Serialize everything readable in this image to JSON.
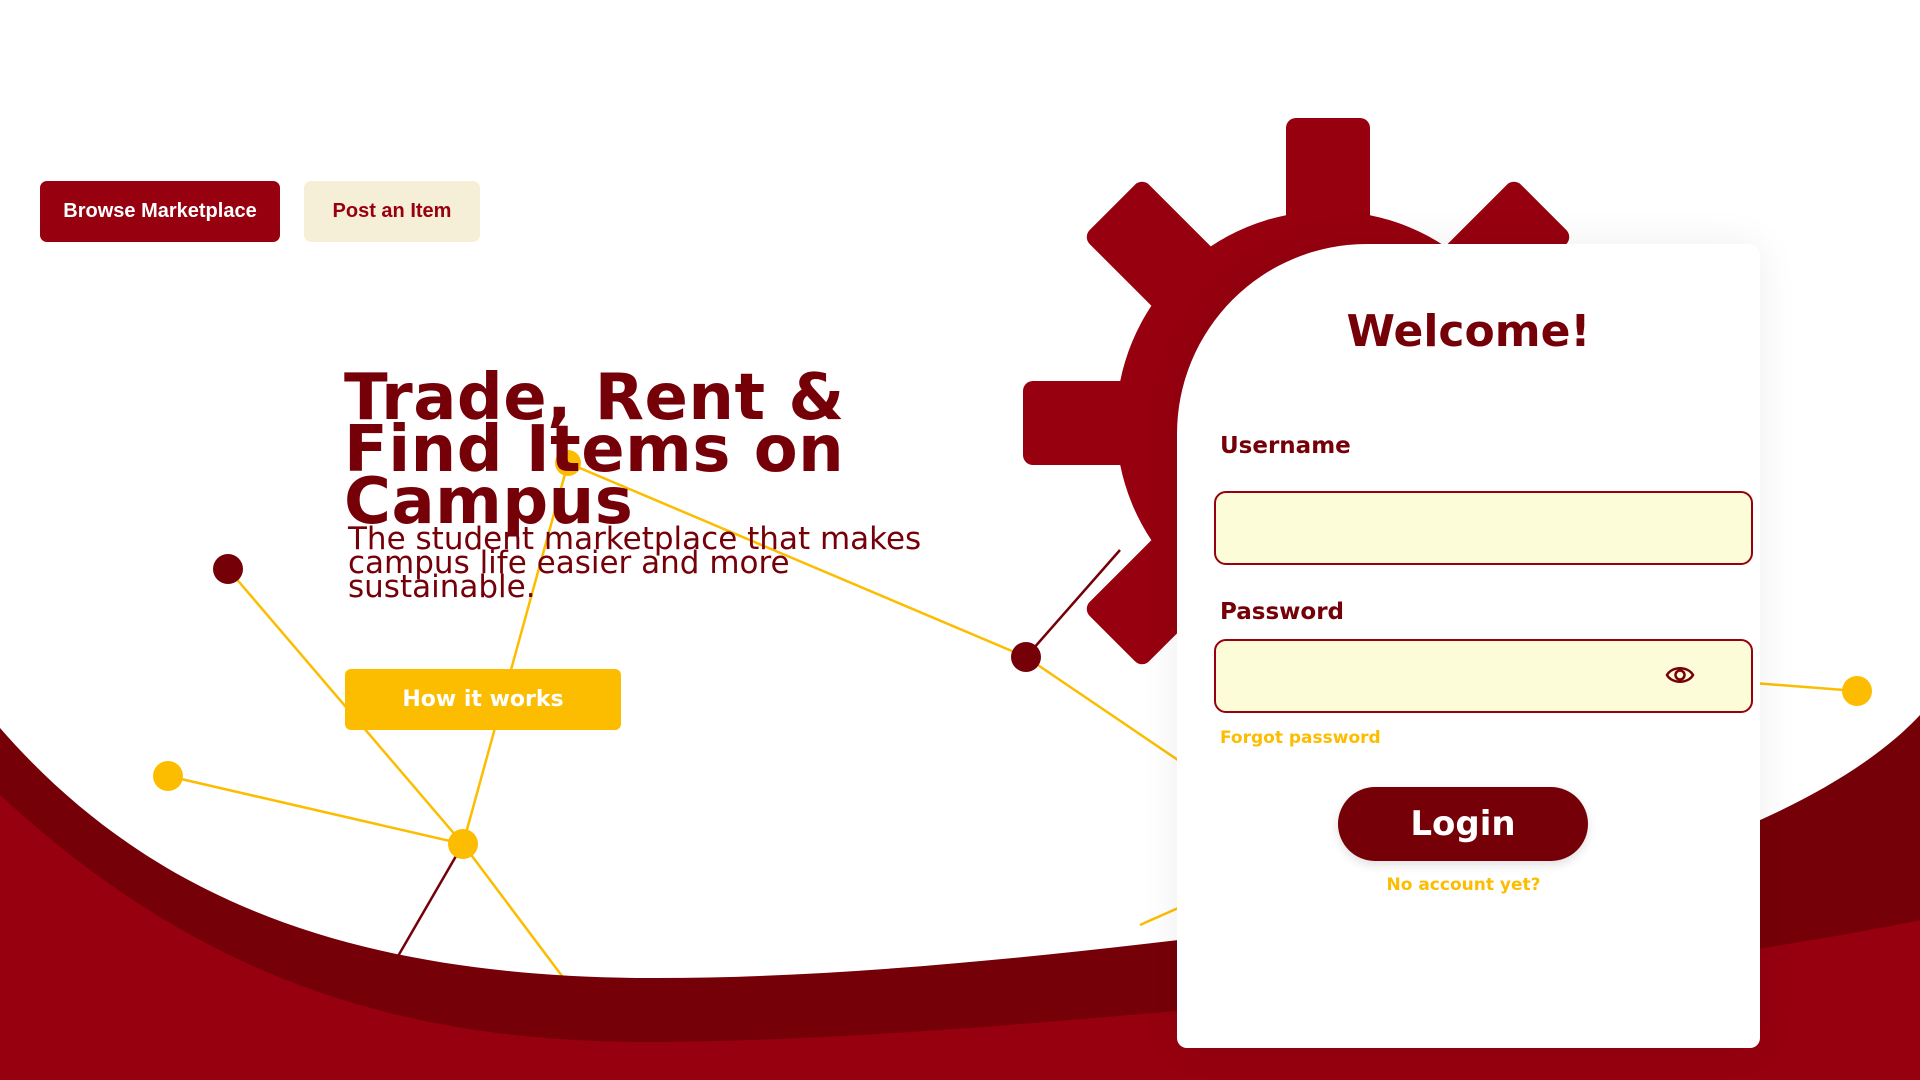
{
  "nav": {
    "browse_label": "Browse Marketplace",
    "post_label": "Post an Item"
  },
  "hero": {
    "title": "Trade, Rent & Find Items on Campus",
    "subtitle": "The student marketplace that makes campus life easier and more sustainable.",
    "how_label": "How it works"
  },
  "login": {
    "welcome": "Welcome!",
    "username_label": "Username",
    "username_value": "",
    "password_label": "Password",
    "password_value": "",
    "forgot_label": "Forgot password",
    "login_label": "Login",
    "no_account_label": "No account yet?"
  },
  "icons": {
    "password_toggle": "eye-icon",
    "decoration": "gear-icon"
  },
  "colors": {
    "primary": "#96000f",
    "dark": "#760008",
    "accent": "#fcbd00",
    "input_bg": "#fdfcd8",
    "secondary_button_bg": "#f6efd8"
  }
}
